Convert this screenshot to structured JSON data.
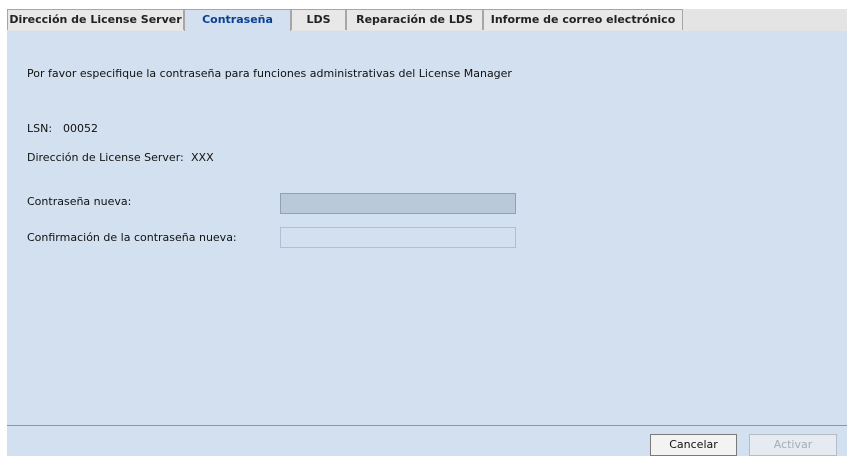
{
  "tabs": [
    {
      "label": "Dirección de License Server",
      "active": false
    },
    {
      "label": "Contraseña",
      "active": true
    },
    {
      "label": "LDS",
      "active": false
    },
    {
      "label": "Reparación de LDS",
      "active": false
    },
    {
      "label": "Informe de correo electrónico",
      "active": false
    }
  ],
  "content": {
    "instructions": "Por favor especifique la contraseña para funciones administrativas del License Manager",
    "lsn_label": "LSN:",
    "lsn_value": "00052",
    "server_address_label": "Dirección de License Server:",
    "server_address_value": "XXX",
    "new_password_label": "Contraseña nueva:",
    "new_password_value": "",
    "confirm_password_label": "Confirmación de la contraseña nueva:",
    "confirm_password_value": ""
  },
  "buttons": {
    "cancel_label": "Cancelar",
    "activate_label": "Activar",
    "activate_enabled": false
  },
  "colors": {
    "panel_background": "#d3e0ef",
    "active_tab_text": "#0b3f8f",
    "disabled_button_text": "#a3abb5"
  }
}
